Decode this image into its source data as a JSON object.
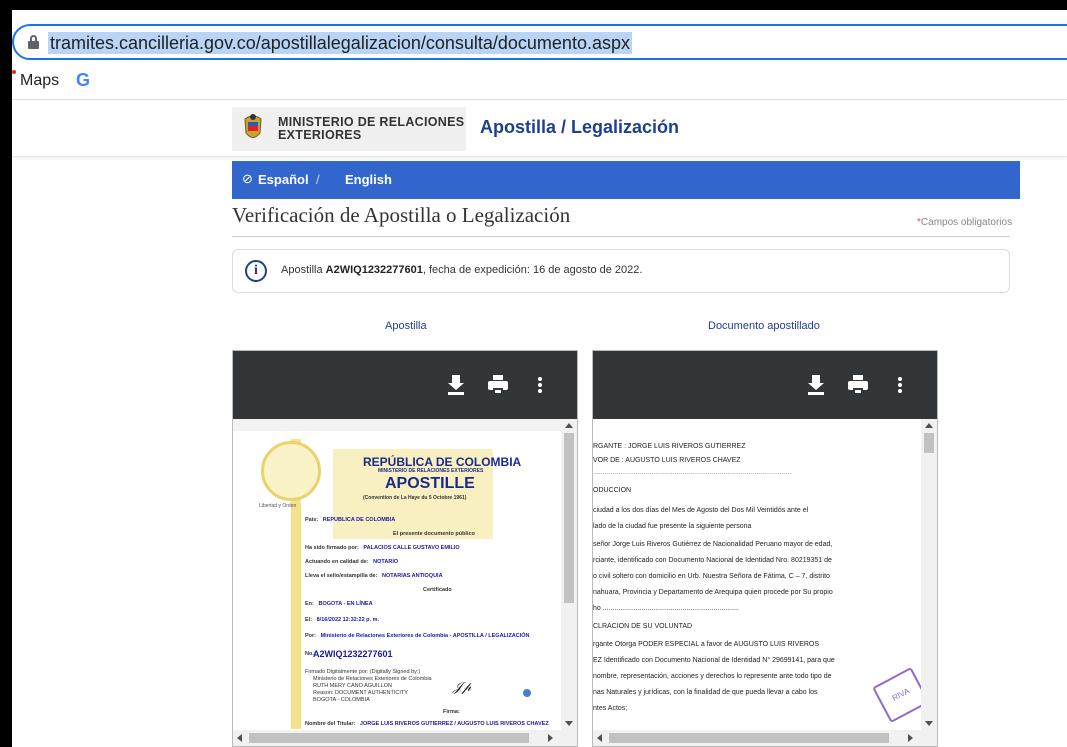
{
  "browser": {
    "url": "tramites.cancilleria.gov.co/apostillalegalizacion/consulta/documento.aspx",
    "bookmarks": [
      {
        "label": "Maps"
      },
      {
        "label": "G"
      }
    ]
  },
  "header": {
    "ministry_line1": "MINISTERIO DE RELACIONES",
    "ministry_line2": "EXTERIORES",
    "site_title": "Apostilla / Legalización"
  },
  "lang": {
    "icon": "⊘",
    "spanish": "Español",
    "separator": "/",
    "english": "English"
  },
  "page": {
    "title": "Verificación de Apostilla o Legalización",
    "required_star": "*",
    "required_note": "Campos obligatorios"
  },
  "info": {
    "icon": "i",
    "prefix": "Apostilla ",
    "code": "A2WIQ1232277601",
    "suffix": ", fecha de expedición: 16 de agosto de 2022."
  },
  "columns": {
    "left_label": "Apostilla",
    "right_label": "Documento apostillado"
  },
  "apostille_doc": {
    "seal_caption": "Libertad y Orden",
    "republic": "REPÚBLICA DE COLOMBIA",
    "ministry": "MINISTERIO DE RELACIONES EXTERIORES",
    "apostille": "APOSTILLE",
    "convention": "(Convention de La Haye du 5 Octobre 1961)",
    "fields": [
      {
        "label": "País:",
        "value": "REPUBLICA DE COLOMBIA"
      },
      {
        "label": "",
        "value": "El presente documento público"
      },
      {
        "label": "Ha sido firmado por:",
        "value": "PALACIOS CALLE GUSTAVO EMILIO"
      },
      {
        "label": "Actuando en calidad de:",
        "value": "NOTARIO"
      },
      {
        "label": "Lleva el sello/estampilla de:",
        "value": "NOTARIAS ANTIOQUIA"
      },
      {
        "label": "",
        "value": "Certificado"
      },
      {
        "label": "En:",
        "value": "BOGOTA - EN LÍNEA"
      },
      {
        "label": "El:",
        "value": "8/16/2022 12:32:22 p. m."
      },
      {
        "label": "Por:",
        "value": "Ministerio de Relaciones Exteriores de Colombia - APOSTILLA / LEGALIZACIÓN"
      },
      {
        "label": "No.:",
        "value": ""
      }
    ],
    "number": "A2WIQ1232277601",
    "signed_block": [
      "Firmado Digitalmente por: (Digitally Signed by:)",
      "Ministerio de Relaciones Exteriores de Colombia",
      "RUTH MERY CANO AGUILLON",
      "Reason: DOCUMENT AUTHENTICITY",
      "BOGOTA - COLOMBIA"
    ],
    "firma_label": "Firma:",
    "holder_label": "Nombre del Titular:",
    "holder_value": "JORGE LUIS RIVEROS GUTIERREZ / AUGUSTO LUIS RIVEROS CHAVEZ"
  },
  "notarial_doc": {
    "lines": [
      "RGANTE      : JORGE LUIS RIVEROS GUTIERREZ",
      "VOR DE      : AUGUSTO LUIS RIVEROS CHAVEZ",
      "......................................................................................................",
      "ODUCCION",
      "ciudad a los dos días del Mes de Agosto del Dos Mil Veintidós ante el",
      "lado de la ciudad fue presente la siguiente persona",
      "señor Jorge Luis Riveros Gutiérrez de Nacionalidad Peruano mayor de edad,",
      "rciante, identificado con Documento Nacional de Identidad Nro. 80219351 de",
      "o civil soltero con domicilio en Urb. Nuestra Señora de Fátima, C – 7, distrito",
      "nahuara, Provincia y Departamento de Arequipa quien procede por Su propio",
      "ho ......................................................................",
      "CLRACION DE SU VOLUNTAD",
      "rgante Otorga PODER ESPECIAL a favor de AUGUSTO LUIS RIVEROS",
      "EZ Identificado con Documento Nacional de Identidad N° 29699141, para que",
      "nombre, representación, acciones y derechos lo represente ante todo tipo de",
      "nas Naturales y jurídicas, con la finalidad de que pueda llevar a cabo los",
      "ntes Actos;"
    ],
    "stamp_text": "RIVA"
  },
  "colors": {
    "accent": "#3366cc",
    "title_blue": "#1f3f8f",
    "toolbar": "#323639"
  }
}
